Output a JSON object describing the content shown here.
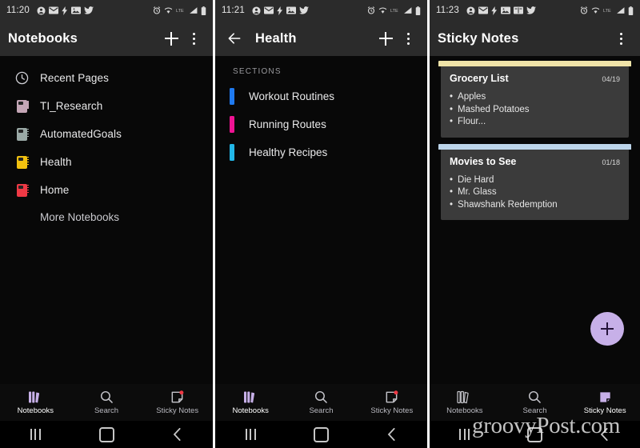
{
  "panels": [
    {
      "status": {
        "time": "11:20",
        "left_icons": [
          "account-icon",
          "mail-icon",
          "bolt-icon",
          "photo-icon",
          "twitter-icon"
        ],
        "right_icons": [
          "alarm-icon",
          "wifi-icon",
          "lte-icon",
          "signal-icon",
          "battery-icon"
        ]
      },
      "appbar": {
        "title": "Notebooks",
        "has_back": false,
        "add_label": "+",
        "menu_label": "more-options"
      },
      "list": [
        {
          "label": "Recent Pages",
          "icon": "clock-icon",
          "color": "#d0d0d6"
        },
        {
          "label": "TI_Research",
          "icon": "notebook-icon",
          "color": "#c4a6b6"
        },
        {
          "label": "AutomatedGoals",
          "icon": "notebook-icon",
          "color": "#9aa9a6"
        },
        {
          "label": "Health",
          "icon": "notebook-icon",
          "color": "#f2c10f"
        },
        {
          "label": "Home",
          "icon": "notebook-icon",
          "color": "#ef3945"
        }
      ],
      "more_label": "More Notebooks",
      "bottom_nav": [
        {
          "label": "Notebooks",
          "icon": "books-icon",
          "active": true
        },
        {
          "label": "Search",
          "icon": "search-icon",
          "active": false
        },
        {
          "label": "Sticky Notes",
          "icon": "sticky-note-icon",
          "active": false
        }
      ]
    },
    {
      "status": {
        "time": "11:21",
        "left_icons": [
          "account-icon",
          "mail-icon",
          "bolt-icon",
          "photo-icon",
          "twitter-icon"
        ],
        "right_icons": [
          "alarm-icon",
          "wifi-icon",
          "lte-icon",
          "signal-icon",
          "battery-icon"
        ]
      },
      "appbar": {
        "title": "Health",
        "has_back": true,
        "add_label": "+",
        "menu_label": "more-options"
      },
      "section_header": "SECTIONS",
      "sections": [
        {
          "label": "Workout Routines",
          "color": "#1f7af0"
        },
        {
          "label": "Running Routes",
          "color": "#ef1393"
        },
        {
          "label": "Healthy Recipes",
          "color": "#22b7e8"
        }
      ],
      "bottom_nav": [
        {
          "label": "Notebooks",
          "icon": "books-icon",
          "active": true
        },
        {
          "label": "Search",
          "icon": "search-icon",
          "active": false
        },
        {
          "label": "Sticky Notes",
          "icon": "sticky-note-icon",
          "active": false
        }
      ]
    },
    {
      "status": {
        "time": "11:23",
        "left_icons": [
          "account-icon",
          "mail-icon",
          "bolt-icon",
          "photo-icon",
          "book-icon",
          "twitter-icon"
        ],
        "right_icons": [
          "alarm-icon",
          "wifi-icon",
          "lte-icon",
          "signal-icon",
          "battery-icon"
        ]
      },
      "appbar": {
        "title": "Sticky Notes",
        "has_back": false,
        "menu_label": "more-options"
      },
      "notes": [
        {
          "title": "Grocery List",
          "date": "04/19",
          "strip_color": "#efe3a8",
          "items": [
            "Apples",
            "Mashed Potatoes",
            "Flour..."
          ]
        },
        {
          "title": "Movies to See",
          "date": "01/18",
          "strip_color": "#bcd4ea",
          "items": [
            "Die Hard",
            "Mr. Glass",
            "Shawshank Redemption"
          ]
        }
      ],
      "fab": {
        "label": "+",
        "color": "#c7b0e8"
      },
      "bottom_nav": [
        {
          "label": "Notebooks",
          "icon": "books-icon",
          "active": false
        },
        {
          "label": "Search",
          "icon": "search-icon",
          "active": false
        },
        {
          "label": "Sticky Notes",
          "icon": "sticky-note-icon",
          "active": true
        }
      ]
    }
  ],
  "system_nav": {
    "recents": "recents-button",
    "home": "home-button",
    "back": "back-button"
  },
  "watermark": "groovyPost.com",
  "theme": {
    "appbar_bg": "#2b2b2b",
    "content_bg": "#080808",
    "accent": "#c7b0e8",
    "note_bg": "#3b3b3b"
  }
}
